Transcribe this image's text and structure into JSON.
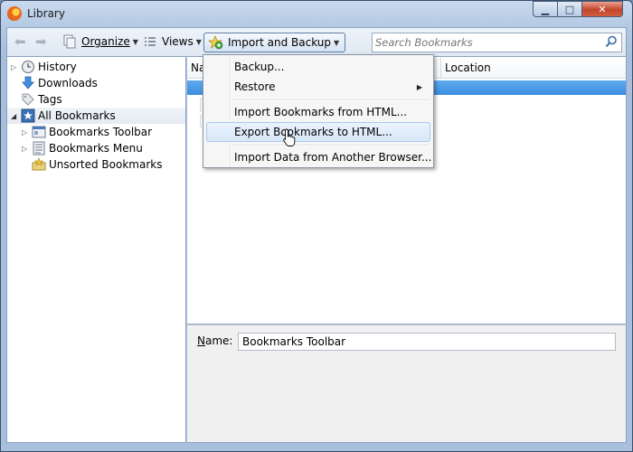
{
  "window": {
    "title": "Library",
    "controls": {
      "minimize": "▁",
      "maximize": "□",
      "close": "✕"
    }
  },
  "toolbar": {
    "back_icon": "back-arrow-icon",
    "forward_icon": "forward-arrow-icon",
    "organize_label": "Organize",
    "views_label": "Views",
    "import_backup_label": "Import and Backup",
    "search_placeholder": "Search Bookmarks"
  },
  "sidebar": {
    "items": [
      {
        "label": "History",
        "icon": "history-clock-icon",
        "expandable": true,
        "expanded": false,
        "level": 0
      },
      {
        "label": "Downloads",
        "icon": "download-arrow-icon",
        "expandable": false,
        "level": 0
      },
      {
        "label": "Tags",
        "icon": "tag-icon",
        "expandable": false,
        "level": 0
      },
      {
        "label": "All Bookmarks",
        "icon": "bookmarks-star-icon",
        "expandable": true,
        "expanded": true,
        "level": 0,
        "selected": true
      },
      {
        "label": "Bookmarks Toolbar",
        "icon": "bookmarks-toolbar-icon",
        "expandable": true,
        "expanded": false,
        "level": 1
      },
      {
        "label": "Bookmarks Menu",
        "icon": "bookmarks-menu-icon",
        "expandable": true,
        "expanded": false,
        "level": 1
      },
      {
        "label": "Unsorted Bookmarks",
        "icon": "unsorted-bookmarks-icon",
        "expandable": false,
        "level": 1
      }
    ]
  },
  "list": {
    "columns": [
      "Na",
      "Location"
    ]
  },
  "details": {
    "name_label": "Name:",
    "name_value": "Bookmarks Toolbar"
  },
  "import_menu": {
    "items": [
      {
        "label": "Backup...",
        "has_submenu": false
      },
      {
        "label": "Restore",
        "has_submenu": true
      },
      {
        "label": "Import Bookmarks from HTML...",
        "has_submenu": false
      },
      {
        "label": "Export Bookmarks to HTML...",
        "has_submenu": false,
        "hovered": true
      },
      {
        "label": "Import Data from Another Browser...",
        "has_submenu": false
      }
    ]
  },
  "colors": {
    "selection_blue": "#3a8ee0",
    "menu_hover": "#d7e7f9",
    "frame_blue": "#a7bedd"
  }
}
